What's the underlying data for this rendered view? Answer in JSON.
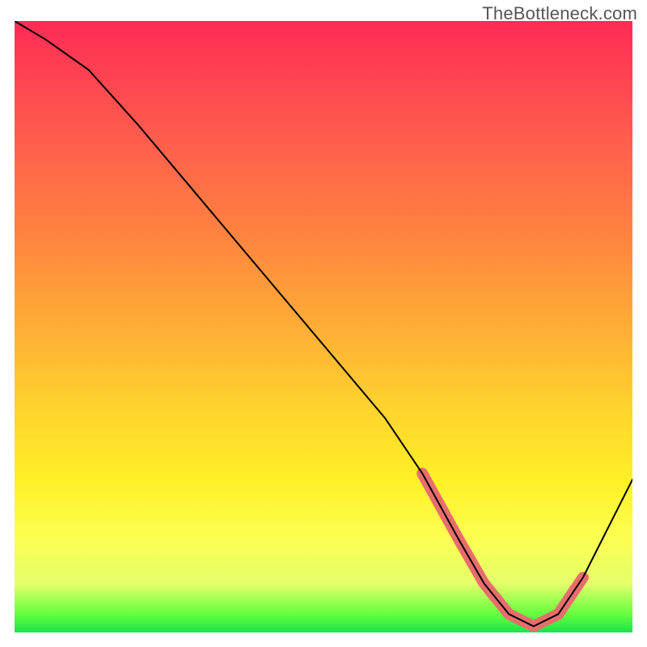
{
  "watermark": "TheBottleneck.com",
  "chart_data": {
    "type": "line",
    "title": "",
    "xlabel": "",
    "ylabel": "",
    "xlim": [
      0,
      100
    ],
    "ylim": [
      0,
      100
    ],
    "series": [
      {
        "name": "bottleneck-curve",
        "x": [
          0,
          5,
          12,
          20,
          30,
          40,
          50,
          60,
          66,
          72,
          76,
          80,
          84,
          88,
          92,
          100
        ],
        "values": [
          100,
          97,
          92,
          83,
          71,
          59,
          47,
          35,
          26,
          15,
          8,
          3,
          1,
          3,
          9,
          25
        ]
      },
      {
        "name": "optimal-range-highlight",
        "x": [
          66,
          72,
          76,
          80,
          84,
          88,
          92
        ],
        "values": [
          26,
          15,
          8,
          3,
          1,
          3,
          9
        ]
      }
    ],
    "background_gradient_stops": [
      {
        "pct": 0,
        "color": "#ff2b55"
      },
      {
        "pct": 18,
        "color": "#ff5a4e"
      },
      {
        "pct": 35,
        "color": "#ff8340"
      },
      {
        "pct": 50,
        "color": "#ffad36"
      },
      {
        "pct": 63,
        "color": "#ffd22e"
      },
      {
        "pct": 75,
        "color": "#fff026"
      },
      {
        "pct": 85,
        "color": "#fbff53"
      },
      {
        "pct": 92,
        "color": "#e4ff6a"
      },
      {
        "pct": 97,
        "color": "#66ff3f"
      },
      {
        "pct": 100,
        "color": "#19e44a"
      }
    ]
  }
}
